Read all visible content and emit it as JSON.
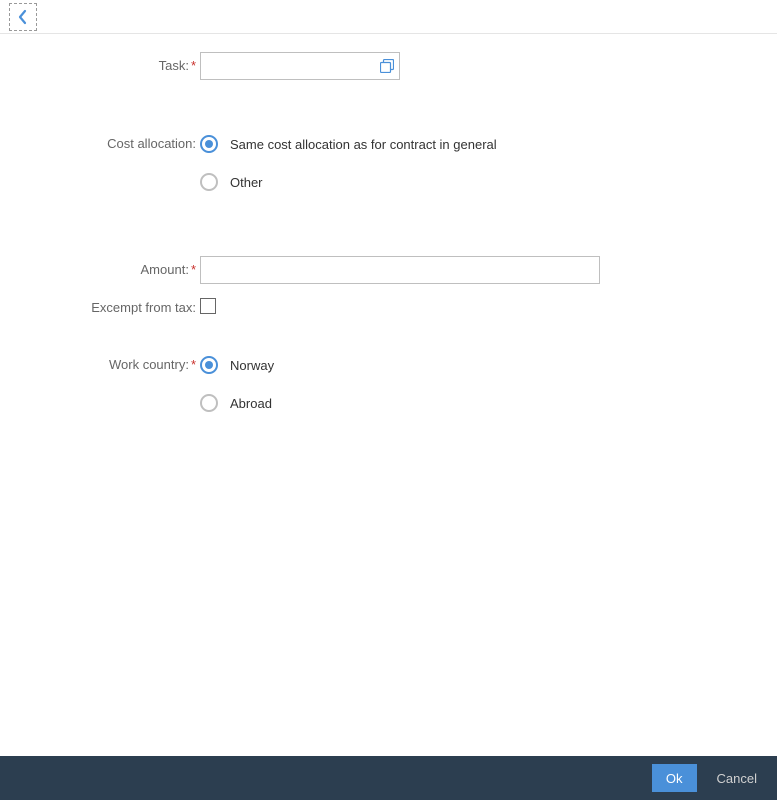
{
  "form": {
    "task": {
      "label": "Task:",
      "required": true,
      "value": ""
    },
    "cost_allocation": {
      "label": "Cost allocation:",
      "options": [
        {
          "label": "Same cost allocation as for contract in general",
          "selected": true
        },
        {
          "label": "Other",
          "selected": false
        }
      ]
    },
    "amount": {
      "label": "Amount:",
      "required": true,
      "value": ""
    },
    "exempt_tax": {
      "label": "Excempt from tax:",
      "checked": false
    },
    "work_country": {
      "label": "Work country:",
      "required": true,
      "options": [
        {
          "label": "Norway",
          "selected": true
        },
        {
          "label": "Abroad",
          "selected": false
        }
      ]
    }
  },
  "footer": {
    "ok": "Ok",
    "cancel": "Cancel"
  }
}
